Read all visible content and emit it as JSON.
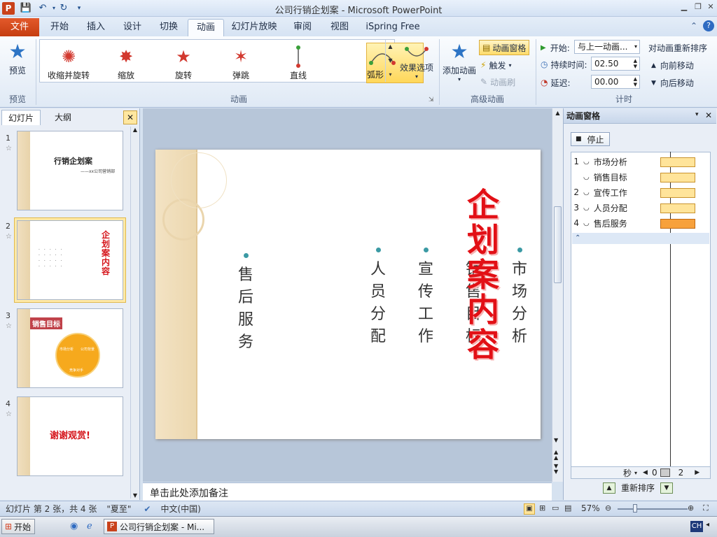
{
  "window": {
    "title": "公司行销企划案 - Microsoft PowerPoint",
    "app_icon": "P"
  },
  "ribbon_tabs": [
    "文件",
    "开始",
    "插入",
    "设计",
    "切换",
    "动画",
    "幻灯片放映",
    "审阅",
    "视图",
    "iSpring Free"
  ],
  "ribbon": {
    "preview": {
      "label": "预览",
      "group": "预览"
    },
    "animation_group": "动画",
    "animations": [
      {
        "label": "收缩并旋转",
        "icon": "shrink-spin-icon"
      },
      {
        "label": "缩放",
        "icon": "zoom-star-icon"
      },
      {
        "label": "旋转",
        "icon": "spin-star-icon"
      },
      {
        "label": "弹跳",
        "icon": "bounce-icon"
      },
      {
        "label": "直线",
        "icon": "line-path-icon"
      },
      {
        "label": "弧形",
        "icon": "arc-path-icon"
      }
    ],
    "effect_options": "效果选项",
    "advanced": {
      "group": "高级动画",
      "add_animation": "添加动画",
      "pane": "动画窗格",
      "trigger": "触发",
      "painter": "动画刷"
    },
    "timing": {
      "group": "计时",
      "start_label": "开始:",
      "start_value": "与上一动画...",
      "duration_label": "持续时间:",
      "duration_value": "02.50",
      "delay_label": "延迟:",
      "delay_value": "00.00",
      "reorder": "对动画重新排序",
      "forward": "向前移动",
      "backward": "向后移动"
    }
  },
  "left_panel": {
    "tabs": [
      "幻灯片",
      "大纲"
    ]
  },
  "thumbs": {
    "s1_title": "行销企划案",
    "s1_sub": "——xx公司营销部",
    "s2_title": "企划案内容",
    "s3_title": "销售目标",
    "s3_seg1": "市场分析",
    "s3_seg2": "公司背景",
    "s3_seg3": "竞争对手",
    "s4_title": "谢谢观赏!"
  },
  "slide": {
    "title": "企划案内容",
    "items": [
      "市场分析",
      "销售目标",
      "宣传工作",
      "人员分配",
      "售后服务"
    ]
  },
  "notes_placeholder": "单击此处添加备注",
  "anim_pane": {
    "title": "动画窗格",
    "stop": "停止",
    "items": [
      {
        "num": "1",
        "name": "市场分析"
      },
      {
        "num": "",
        "name": "销售目标"
      },
      {
        "num": "2",
        "name": "宣传工作"
      },
      {
        "num": "3",
        "name": "人员分配"
      },
      {
        "num": "4",
        "name": "售后服务"
      }
    ],
    "seconds": "秒",
    "tl_start": "0",
    "tl_end": "2",
    "reorder": "重新排序"
  },
  "status": {
    "slide_info": "幻灯片 第 2 张，共 4 张",
    "theme": "\"夏至\"",
    "lang": "中文(中国)",
    "zoom": "57%"
  },
  "taskbar": {
    "start": "开始",
    "task": "公司行销企划案 - Mi...",
    "ime": "CH"
  }
}
